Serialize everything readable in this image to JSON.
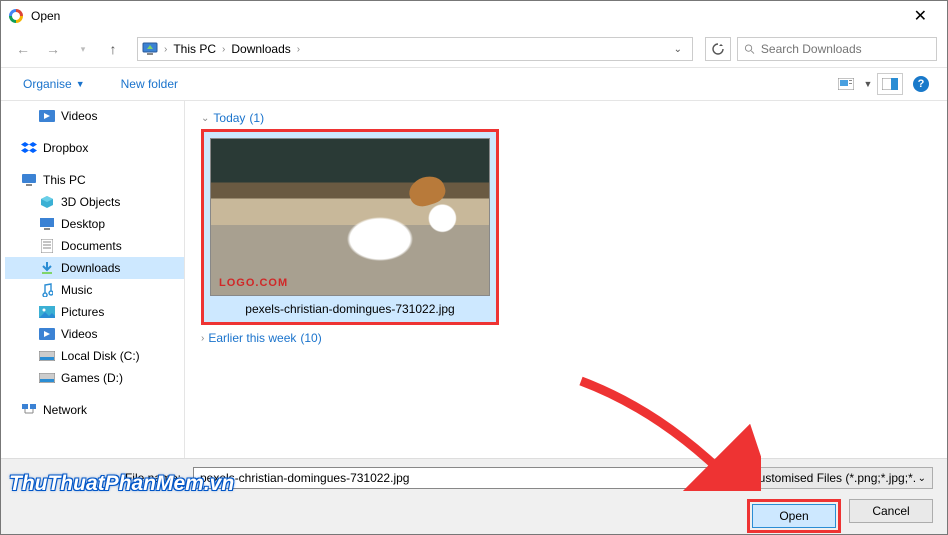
{
  "title": "Open",
  "breadcrumbs": {
    "root": "This PC",
    "folder": "Downloads"
  },
  "search": {
    "placeholder": "Search Downloads"
  },
  "toolbar": {
    "organise": "Organise",
    "new_folder": "New folder"
  },
  "sidebar": {
    "items": [
      {
        "label": "Videos",
        "kind": "videos",
        "level": 1
      },
      {
        "label": "Dropbox",
        "kind": "dropbox",
        "level": 0
      },
      {
        "label": "This PC",
        "kind": "pc",
        "level": 0
      },
      {
        "label": "3D Objects",
        "kind": "3d",
        "level": 1
      },
      {
        "label": "Desktop",
        "kind": "desktop",
        "level": 1
      },
      {
        "label": "Documents",
        "kind": "documents",
        "level": 1
      },
      {
        "label": "Downloads",
        "kind": "downloads",
        "level": 1,
        "selected": true
      },
      {
        "label": "Music",
        "kind": "music",
        "level": 1
      },
      {
        "label": "Pictures",
        "kind": "pictures",
        "level": 1
      },
      {
        "label": "Videos",
        "kind": "videos",
        "level": 1
      },
      {
        "label": "Local Disk (C:)",
        "kind": "disk",
        "level": 1
      },
      {
        "label": "Games (D:)",
        "kind": "disk",
        "level": 1
      },
      {
        "label": "Network",
        "kind": "network",
        "level": 0
      }
    ]
  },
  "groups": {
    "today": {
      "label": "Today",
      "count": "(1)"
    },
    "earlier": {
      "label": "Earlier this week",
      "count": "(10)"
    }
  },
  "file": {
    "name": "pexels-christian-domingues-731022.jpg",
    "thumb_label": "pexels-christian-domingues-731022.jpg",
    "thumb_watermark": "LOGO.COM"
  },
  "footer": {
    "file_name_label": "File name:",
    "filter": "Customised Files (*.png;*.jpg;*.",
    "open": "Open",
    "cancel": "Cancel"
  },
  "watermark": "ThuThuatPhanMem.vn"
}
